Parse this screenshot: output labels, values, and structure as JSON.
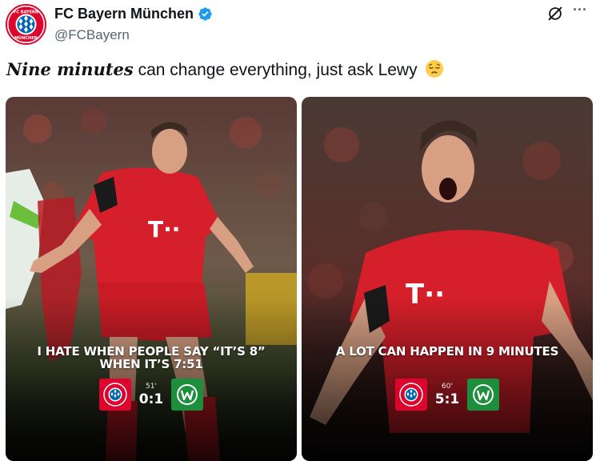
{
  "author": {
    "display_name": "FC Bayern München",
    "handle": "@FCBayern",
    "avatar_text_top": "FC BAYERN",
    "avatar_text_bottom": "MÜNCHEN",
    "verified": true
  },
  "tweet": {
    "text_emphasis": "Nine minutes",
    "text_rest": " can change everything, just ask Lewy",
    "emoji": "pensive-face-emoji"
  },
  "media": [
    {
      "caption_line1": "I HATE WHEN PEOPLE SAY “IT’S 8”",
      "caption_line2": "WHEN IT’S 7:51",
      "minute": "51'",
      "score": "0:1",
      "home_crest": "bayern-crest",
      "away_crest": "wolfsburg-crest"
    },
    {
      "caption_line1": "A LOT CAN HAPPEN IN 9 MINUTES",
      "caption_line2": "",
      "minute": "60'",
      "score": "5:1",
      "home_crest": "bayern-crest",
      "away_crest": "wolfsburg-crest"
    }
  ],
  "icons": {
    "grok": "grok-icon",
    "more": "more-options-icon",
    "verified": "verified-badge-icon"
  },
  "colors": {
    "bayern_red": "#dc052d",
    "wolfsburg_green": "#1d8f3c",
    "verified_blue": "#1d9bf0",
    "text_primary": "#0f1419",
    "text_secondary": "#536471"
  }
}
